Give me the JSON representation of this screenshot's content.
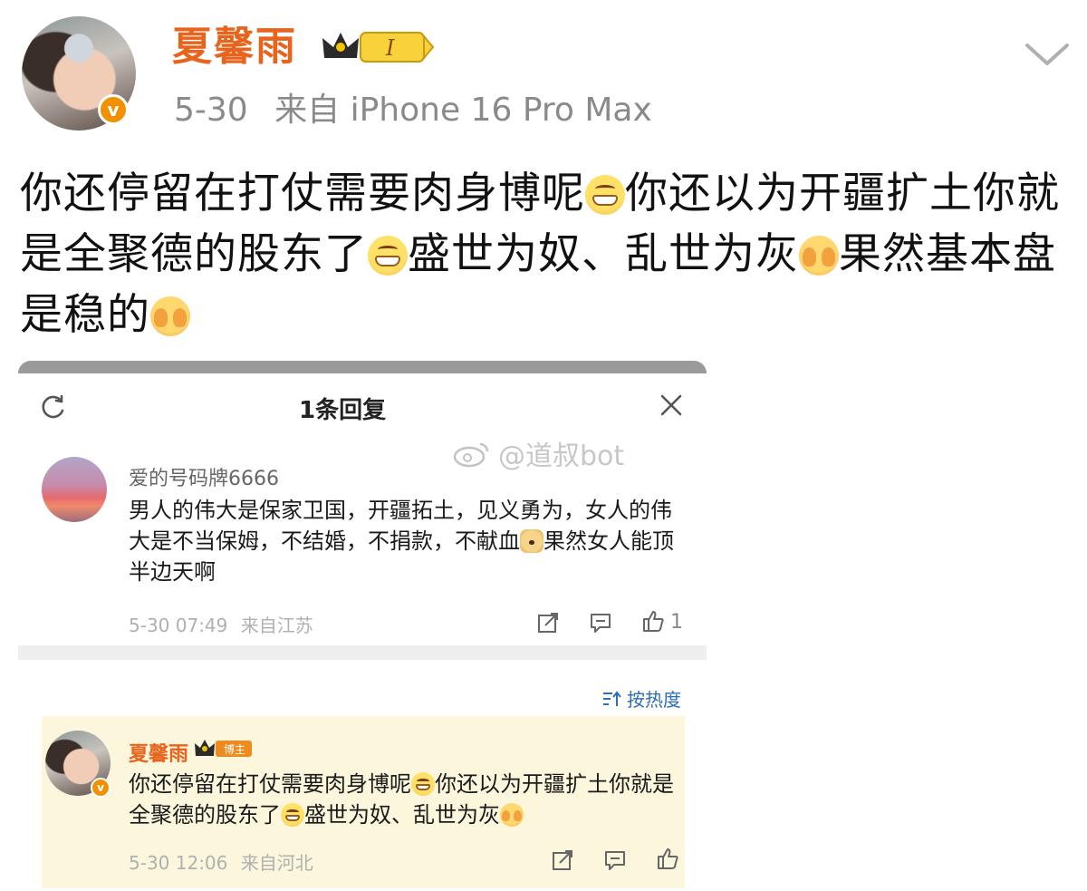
{
  "post": {
    "author": "夏馨雨",
    "level": "I",
    "date": "5-30",
    "source": "来自 iPhone 16 Pro Max",
    "body": [
      {
        "t": "你还停留在打仗需要肉身博呢"
      },
      {
        "emoji": "grin"
      },
      {
        "t": "你还以为开疆扩土你就是全聚德的股东了"
      },
      {
        "emoji": "grin"
      },
      {
        "t": "盛世为奴、乱世为灰"
      },
      {
        "emoji": "cover"
      },
      {
        "t": "果然基本盘是稳的"
      },
      {
        "emoji": "cover"
      }
    ]
  },
  "reply_panel": {
    "title": "1条回复",
    "reply": {
      "author": "爱的号码牌6666",
      "body": [
        {
          "t": "男人的伟大是保家卫国，开疆拓土，见义勇为，女人的伟大是不当保姆，不结婚，不捐款，不献血"
        },
        {
          "emoji": "dog"
        },
        {
          "t": "果然女人能顶半边天啊"
        }
      ],
      "time": "5-30 07:49",
      "location": "来自江苏",
      "likes": "1"
    }
  },
  "watermark": "@道叔bot",
  "sort_label": "按热度",
  "highlight_comment": {
    "author": "夏馨雨",
    "badge": "博主",
    "body": [
      {
        "t": "你还停留在打仗需要肉身博呢"
      },
      {
        "emoji": "grin"
      },
      {
        "t": "你还以为开疆扩土你就是全聚德的股东了"
      },
      {
        "emoji": "grin"
      },
      {
        "t": "盛世为奴、乱世为灰"
      },
      {
        "emoji": "cover"
      }
    ],
    "time": "5-30 12:06",
    "location": "来自河北"
  },
  "colors": {
    "brand_orange": "#e8631c",
    "verified_orange": "#f29100",
    "highlight_bg": "#fbf6dc",
    "link_blue": "#2c6fb8"
  }
}
